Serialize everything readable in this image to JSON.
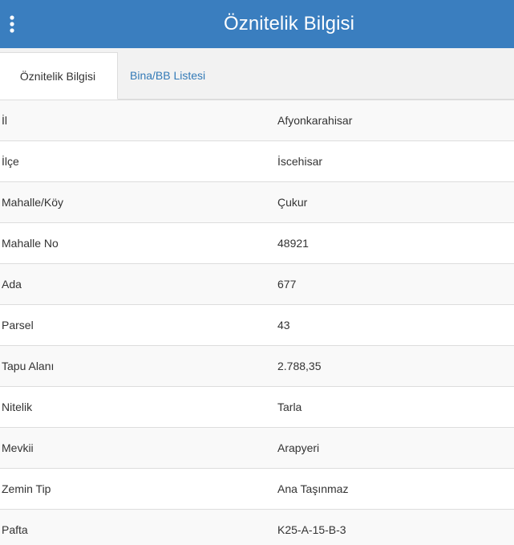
{
  "header": {
    "title": "Öznitelik Bilgisi",
    "menu_icon": "more-vertical-icon",
    "background_color": "#3a7ebf"
  },
  "tabs": [
    {
      "label": "Öznitelik Bilgisi",
      "active": true
    },
    {
      "label": "Bina/BB Listesi",
      "active": false
    }
  ],
  "attributes": [
    {
      "label": "İl",
      "value": "Afyonkarahisar"
    },
    {
      "label": "İlçe",
      "value": "İscehisar"
    },
    {
      "label": "Mahalle/Köy",
      "value": "Çukur"
    },
    {
      "label": "Mahalle No",
      "value": "48921"
    },
    {
      "label": "Ada",
      "value": "677"
    },
    {
      "label": "Parsel",
      "value": "43"
    },
    {
      "label": "Tapu Alanı",
      "value": "2.788,35"
    },
    {
      "label": "Nitelik",
      "value": "Tarla"
    },
    {
      "label": "Mevkii",
      "value": "Arapyeri"
    },
    {
      "label": "Zemin Tip",
      "value": "Ana Taşınmaz"
    },
    {
      "label": "Pafta",
      "value": "K25-A-15-B-3"
    }
  ]
}
